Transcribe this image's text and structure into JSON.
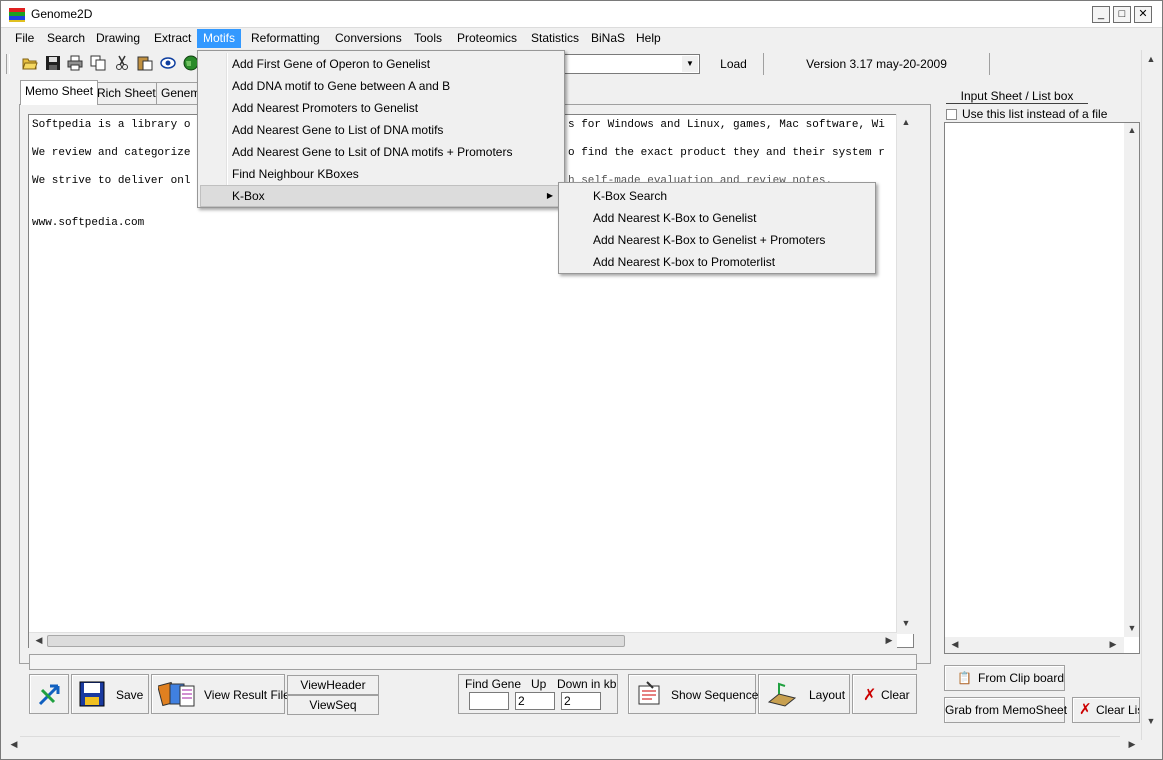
{
  "window": {
    "title": "Genome2D",
    "minimize": "_",
    "maximize": "□",
    "close": "✕"
  },
  "menubar": {
    "items": [
      "File",
      "Search",
      "Drawing",
      "Extract",
      "Motifs",
      "Reformatting",
      "Conversions",
      "Tools",
      "Proteomics",
      "Statistics",
      "BiNaS",
      "Help"
    ],
    "active": "Motifs"
  },
  "toolbar": {
    "icons": [
      "open-folder-icon",
      "save-disk-icon",
      "print-icon",
      "copy-icon",
      "cut-scissors-icon",
      "paste-icon",
      "eye-icon",
      "globe-icon"
    ],
    "load_label": "Load",
    "version": "Version 3.17   may-20-2009"
  },
  "tabs": [
    "Memo Sheet",
    "Rich Sheet",
    "Genem"
  ],
  "memo": {
    "lines": [
      "Softpedia is a library o",
      "We review and categorize",
      "We strive to deliver onl",
      "www.softpedia.com"
    ],
    "right_fragments": [
      "s for Windows and Linux, games, Mac software, Wi",
      "o find the exact product they and their system r",
      "h self-made evaluation and review notes."
    ]
  },
  "motifs_menu": {
    "items": [
      "Add First Gene of Operon to Genelist",
      "Add DNA motif to Gene between A and B",
      "Add Nearest Promoters to Genelist",
      "Add Nearest Gene to List of DNA motifs",
      "Add Nearest Gene to Lsit of DNA motifs + Promoters",
      "Find Neighbour KBoxes",
      "K-Box"
    ],
    "submenu_arrow": "▶"
  },
  "kbox_submenu": {
    "items": [
      "K-Box Search",
      "Add Nearest K-Box to Genelist",
      "Add Nearest K-Box to Genelist + Promoters",
      "Add Nearest K-box to Promoterlist"
    ]
  },
  "bottom": {
    "save": "Save",
    "view_result": "View Result File",
    "view_header": "ViewHeader",
    "view_seq": "ViewSeq",
    "find_gene": "Find Gene",
    "up": "Up",
    "down": "Down in kb",
    "up_value": "2",
    "down_value": "2",
    "show_sequence": "Show Sequence",
    "layout": "Layout",
    "clear": "Clear"
  },
  "right_panel": {
    "title": "Input Sheet / List box",
    "checkbox_label": "Use this list instead of a file",
    "from_clipboard": "From Clip board",
    "grab_memo": "Grab from MemoSheet",
    "clear_list": "Clear List"
  },
  "colors": {
    "menu_highlight": "#3399ff",
    "clear_x": "#cc0000"
  }
}
